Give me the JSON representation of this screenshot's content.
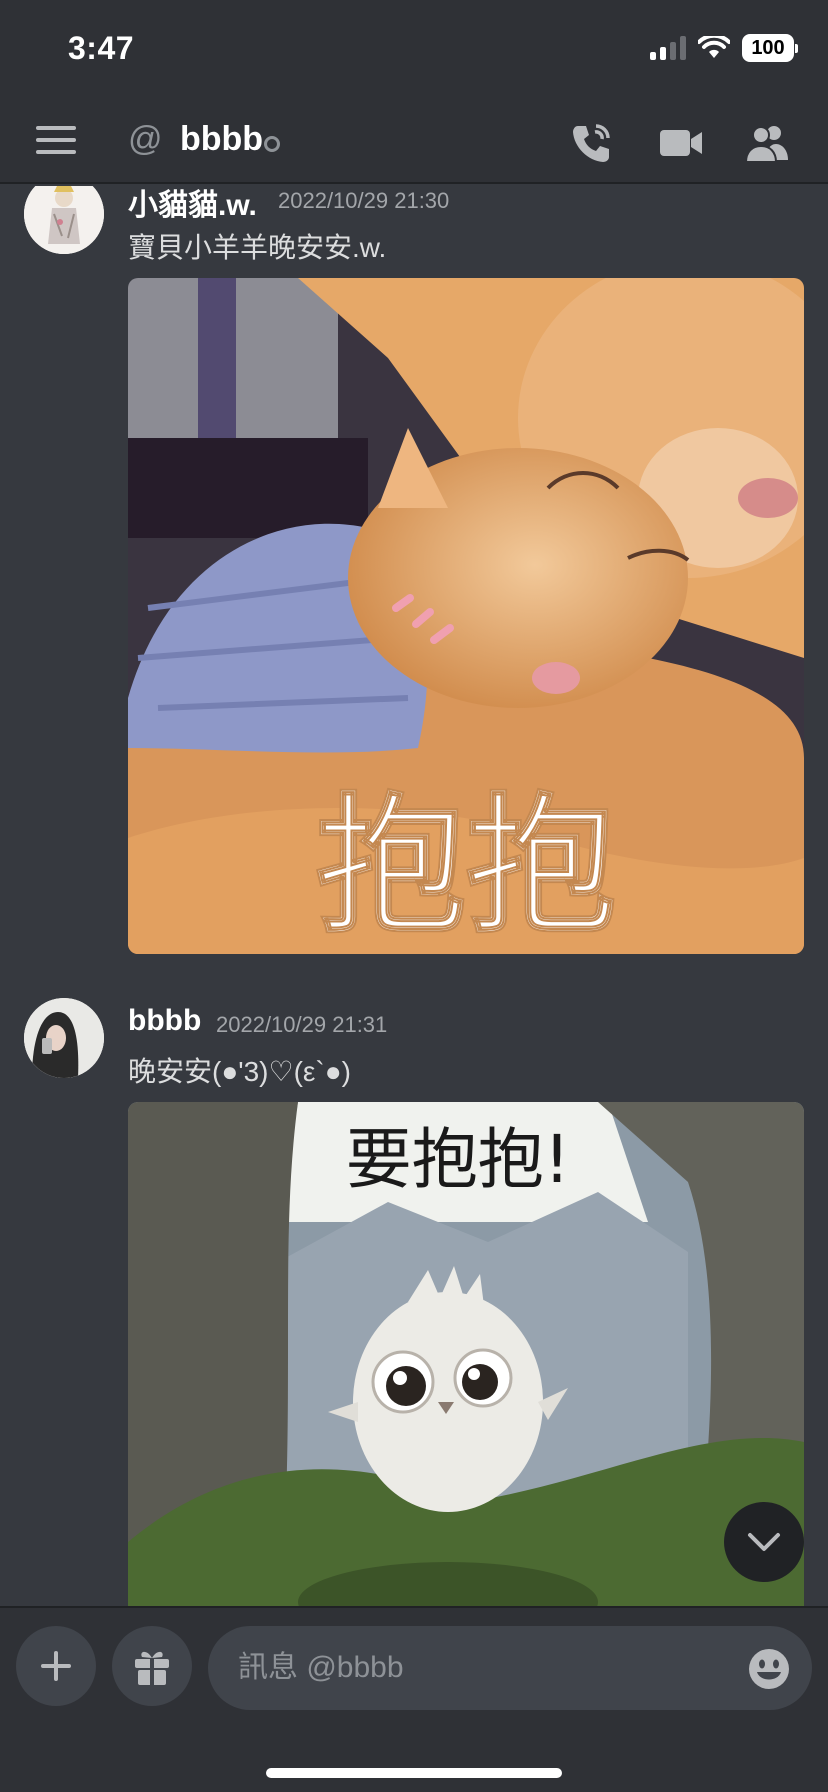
{
  "status_bar": {
    "time": "3:47",
    "battery": "100"
  },
  "header": {
    "at_symbol": "@",
    "channel_name": "bbbb"
  },
  "messages": [
    {
      "author": "小貓貓.w.",
      "timestamp": "2022/10/29 21:30",
      "text": "寶貝小羊羊晚安安.w.",
      "image_caption": "抱抱"
    },
    {
      "author": "bbbb",
      "timestamp": "2022/10/29 21:31",
      "text": "晚安安(●'3)♡(ε`●)",
      "image_caption": "要抱抱!"
    }
  ],
  "composer": {
    "placeholder": "訊息 @bbbb"
  },
  "colors": {
    "background": "#36393f",
    "header": "#2f3136",
    "input": "#40444b",
    "text": "#dcddde",
    "muted": "#a3a6aa"
  }
}
